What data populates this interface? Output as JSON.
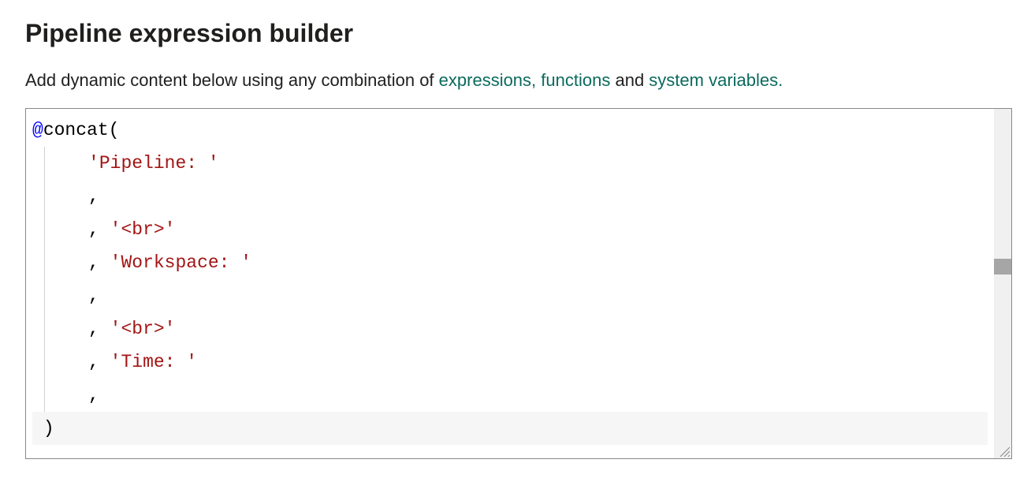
{
  "header": {
    "title": "Pipeline expression builder"
  },
  "subtitle": {
    "prefix": "Add dynamic content below using any combination of ",
    "link_expressions": "expressions,",
    "link_functions": "functions",
    "middle": " and ",
    "link_system_variables": "system variables.",
    "suffix": ""
  },
  "editor": {
    "lines": [
      {
        "type": "open",
        "at": "@",
        "fn": "concat",
        "paren": "("
      },
      {
        "type": "arg",
        "indent": 2,
        "str": "'Pipeline: '"
      },
      {
        "type": "comma",
        "indent": 2,
        "comma": ","
      },
      {
        "type": "argc",
        "indent": 2,
        "comma": ",",
        "str": "'<br>'"
      },
      {
        "type": "argc",
        "indent": 2,
        "comma": ",",
        "str": "'Workspace: '"
      },
      {
        "type": "comma",
        "indent": 2,
        "comma": ","
      },
      {
        "type": "argc",
        "indent": 2,
        "comma": ",",
        "str": "'<br>'"
      },
      {
        "type": "argc",
        "indent": 2,
        "comma": ",",
        "str": "'Time: '"
      },
      {
        "type": "comma",
        "indent": 2,
        "comma": ","
      },
      {
        "type": "close",
        "paren": ")"
      }
    ]
  }
}
